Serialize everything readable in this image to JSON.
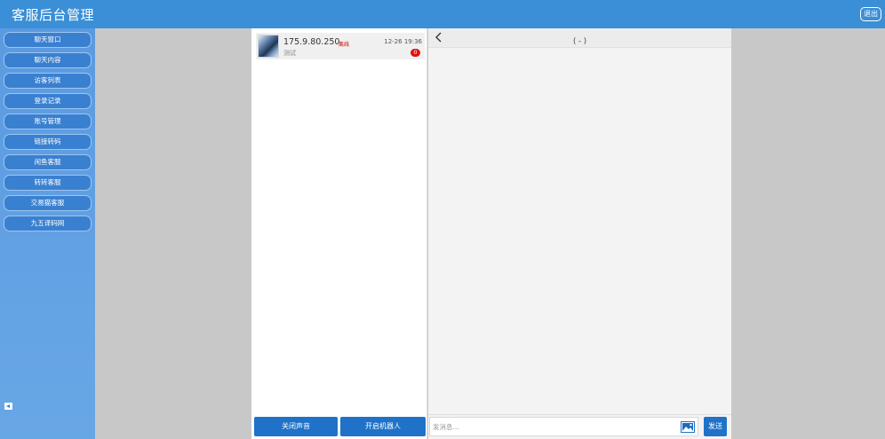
{
  "app": {
    "title": "客服后台管理",
    "logout_label": "退出"
  },
  "sidebar": {
    "items": [
      {
        "label": "聊天窗口"
      },
      {
        "label": "聊天内容"
      },
      {
        "label": "访客列表"
      },
      {
        "label": "登录记录"
      },
      {
        "label": "账号管理"
      },
      {
        "label": "链接转码"
      },
      {
        "label": "闲鱼客服"
      },
      {
        "label": "转转客服"
      },
      {
        "label": "交易猫客服"
      },
      {
        "label": "九五译码网"
      }
    ]
  },
  "session_list": {
    "items": [
      {
        "ip": "175.9.80.250",
        "status": "离线",
        "time": "12-26 19:36",
        "preview": "测试",
        "unread": "0"
      }
    ],
    "buttons": {
      "sound": "关闭声音",
      "robot": "开启机器人"
    }
  },
  "chat": {
    "title": "( - )",
    "input_placeholder": "发消息...",
    "send_label": "发送"
  },
  "colors": {
    "header": "#3a8fd6",
    "primary_button": "#1f72c8",
    "badge": "#e01010",
    "status_offline": "#d00000"
  }
}
